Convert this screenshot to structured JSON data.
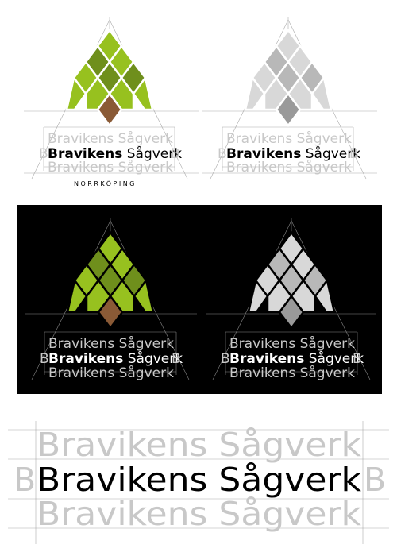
{
  "brand": {
    "name_bold": "Bravikens",
    "name_regular": "Sågverk",
    "ghost_line": "Bravikens Sågverk",
    "ghost_letter": "B",
    "city": "NORRKÖPING"
  },
  "colors": {
    "light_green": "#97c11f",
    "dark_green": "#6f8f1c",
    "brown": "#8a5a36",
    "light_gray": "#d8d8d8",
    "mid_gray": "#b8b8b8",
    "dark_gray": "#9a9a9a",
    "black_panel": "#000000",
    "ghost_text": "#c8c8c8",
    "guide_line": "#999999"
  }
}
